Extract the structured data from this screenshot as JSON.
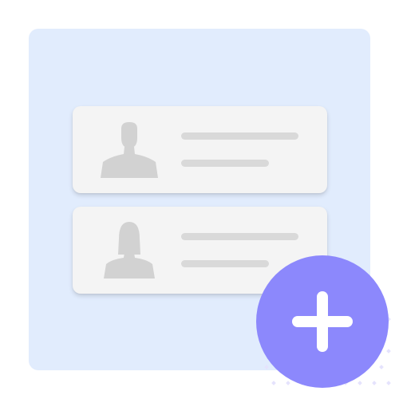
{
  "colors": {
    "panel_background": "#e1ecfd",
    "card_background": "#f4f4f4",
    "placeholder_gray": "#d9d9d9",
    "silhouette_gray": "#d2d2d2",
    "accent_purple": "#8c88fc",
    "plus_white": "#ffffff",
    "dot_lavender": "#e5e3fd"
  },
  "contacts": [
    {
      "avatar_icon": "male-user-silhouette-icon"
    },
    {
      "avatar_icon": "female-user-silhouette-icon"
    }
  ],
  "add_button": {
    "icon": "plus-icon"
  }
}
